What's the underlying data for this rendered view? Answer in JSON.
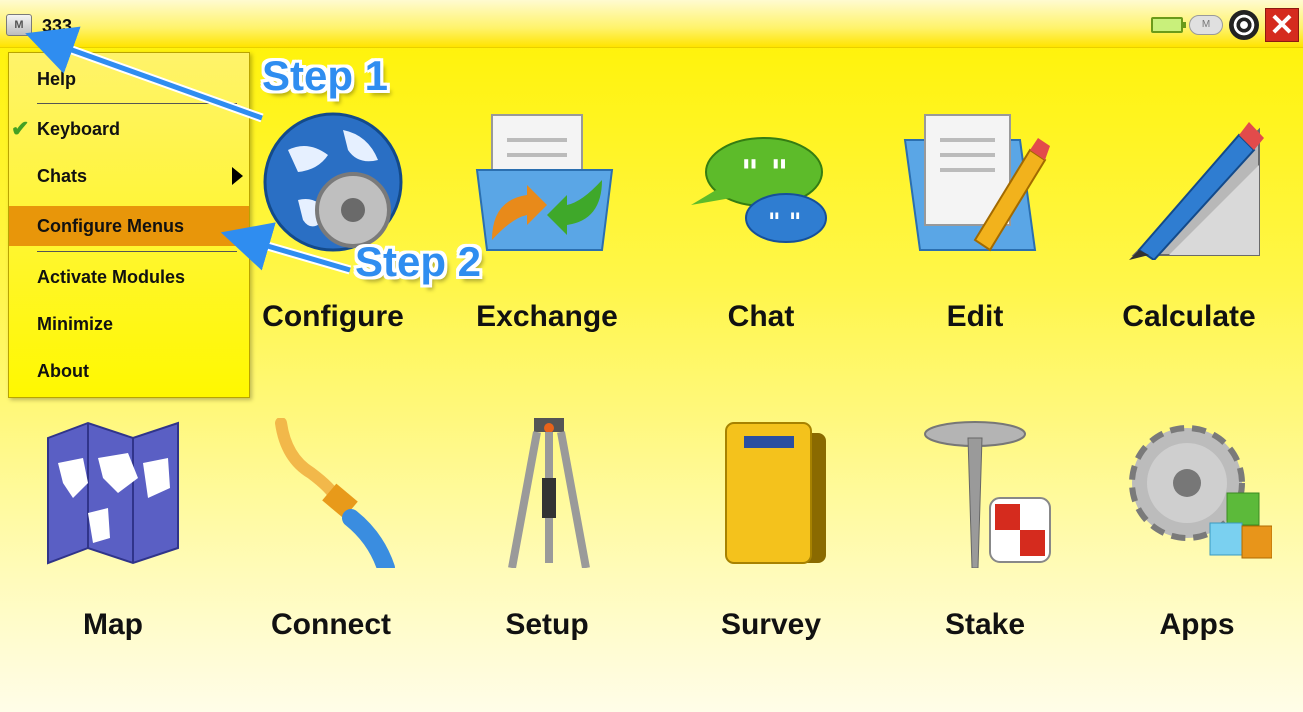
{
  "titlebar": {
    "menu_button_label": "M",
    "title": "333",
    "tray": {
      "battery_icon": "battery-icon",
      "cloud_label": "M",
      "close_glyph": "✕"
    }
  },
  "menu": {
    "items": [
      {
        "label": "Help",
        "checked": false,
        "submenu": false,
        "selected": false
      },
      {
        "label": "Keyboard",
        "checked": true,
        "submenu": false,
        "selected": false
      },
      {
        "label": "Chats",
        "checked": false,
        "submenu": true,
        "selected": false
      },
      {
        "label": "Configure Menus",
        "checked": false,
        "submenu": false,
        "selected": true
      },
      {
        "label": "Activate Modules",
        "checked": false,
        "submenu": false,
        "selected": false
      },
      {
        "label": "Minimize",
        "checked": false,
        "submenu": false,
        "selected": false
      },
      {
        "label": "About",
        "checked": false,
        "submenu": false,
        "selected": false
      }
    ],
    "check_glyph": "✔"
  },
  "tiles": [
    {
      "label": "Configure",
      "icon": "globe-gear-icon"
    },
    {
      "label": "Exchange",
      "icon": "folder-exchange-icon"
    },
    {
      "label": "Chat",
      "icon": "chat-bubbles-icon"
    },
    {
      "label": "Edit",
      "icon": "folder-pencil-icon"
    },
    {
      "label": "Calculate",
      "icon": "pencil-ruler-icon"
    },
    {
      "label": "Map",
      "icon": "world-map-icon"
    },
    {
      "label": "Connect",
      "icon": "cable-icon"
    },
    {
      "label": "Setup",
      "icon": "tripod-icon"
    },
    {
      "label": "Survey",
      "icon": "field-book-icon"
    },
    {
      "label": "Stake",
      "icon": "survey-stake-icon"
    },
    {
      "label": "Apps",
      "icon": "gear-blocks-icon"
    }
  ],
  "annotations": {
    "step1": "Step 1",
    "step2": "Step 2"
  },
  "colors": {
    "background": "#fff200",
    "selected": "#e8960a",
    "step_text": "#2f8df0",
    "close": "#d52b1e"
  }
}
